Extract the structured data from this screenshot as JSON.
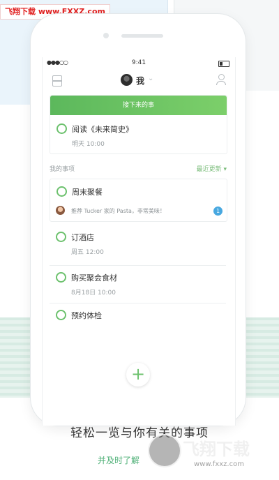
{
  "watermark": {
    "site_top": "飞翔下载 www.FXXZ.com",
    "logo_text": "飞翔下载",
    "logo_url": "www.fxxz.com"
  },
  "status_bar": {
    "signal": "●●●○○",
    "time": "9:41"
  },
  "nav": {
    "title": "我",
    "chevron": "⌄"
  },
  "next_section": {
    "banner": "接下来的事",
    "task": {
      "title": "阅读《未来简史》",
      "time": "明天 10:00"
    }
  },
  "my_items": {
    "label": "我的事项",
    "sort": "最近更新 ▾",
    "tasks": [
      {
        "title": "周末聚餐",
        "comment": "推荐 Tucker 家的 Pasta，非常美味！",
        "badge": "1"
      },
      {
        "title": "订酒店",
        "time": "周五 12:00"
      },
      {
        "title": "购买聚会食材",
        "time": "8月18日 10:00"
      },
      {
        "title": "预约体检"
      }
    ]
  },
  "add_button": "+",
  "caption": "轻松一览与你有关的事项",
  "subcaption": "并及时了解"
}
